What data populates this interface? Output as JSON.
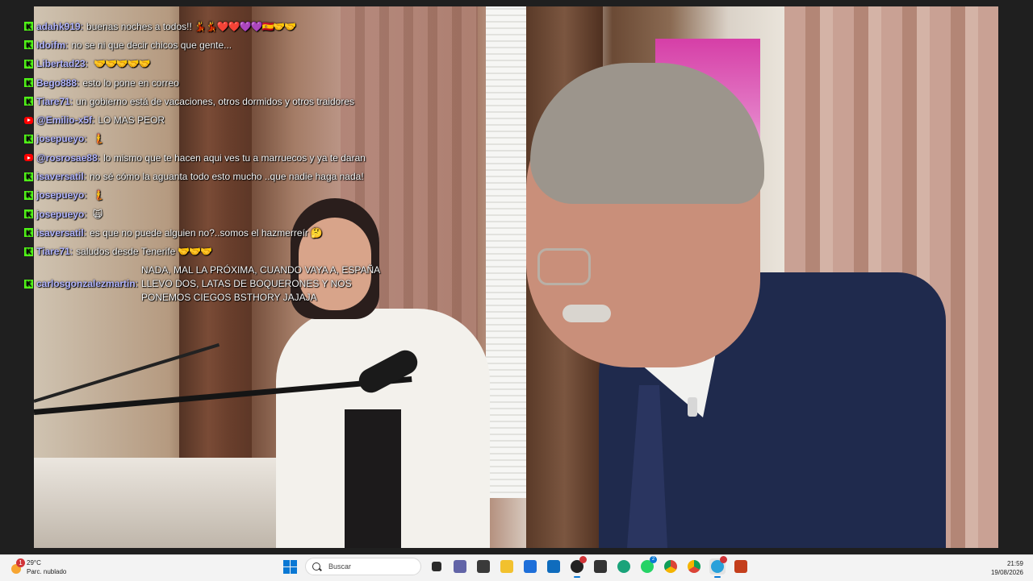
{
  "chat": [
    {
      "platform": "kick",
      "user": "adahk919",
      "text": "buenas noches a todos!!",
      "emotes": "💃💃❤️❤️💜💜🇪🇸🤝🤝"
    },
    {
      "platform": "kick",
      "user": "Idoifm",
      "text": "no se ni que decir chicos que gente...",
      "emotes": ""
    },
    {
      "platform": "kick",
      "user": "Libertad23",
      "text": "",
      "emotes": "🤝🤝🤝🤝🤝"
    },
    {
      "platform": "kick",
      "user": "Bego888",
      "text": "esto lo pone en correo",
      "emotes": ""
    },
    {
      "platform": "kick",
      "user": "Tiare71",
      "text": "un gobierno está de vacaciones, otros dormidos y otros traidores",
      "emotes": ""
    },
    {
      "platform": "youtube",
      "user": "@Emilio-x5f",
      "text": "LO MAS PEOR",
      "emotes": ""
    },
    {
      "platform": "kick",
      "user": "josepueyo",
      "text": "",
      "emotes": "🧜"
    },
    {
      "platform": "youtube",
      "user": "@rosrosae88",
      "text": "lo mismo que te hacen aqui ves tu a marruecos y ya te daran",
      "emotes": ""
    },
    {
      "platform": "kick",
      "user": "isaversatil",
      "text": "no sé cómo la aguanta todo esto mucho ..que nadie haga nada!",
      "emotes": ""
    },
    {
      "platform": "kick",
      "user": "josepueyo",
      "text": "",
      "emotes": "🧜"
    },
    {
      "platform": "kick",
      "user": "josepueyo",
      "text": "",
      "emotes": "🙀"
    },
    {
      "platform": "kick",
      "user": "isaversatil",
      "text": "es que no puede alguien no?..somos el hazmerreír",
      "emotes": "🤔"
    },
    {
      "platform": "kick",
      "user": "Tiare71",
      "text": "saludos desde Tenerife",
      "emotes": "🤝🤝🤝"
    },
    {
      "platform": "kick",
      "user": "carlosgonzalezmartin",
      "text": "NADA, MAL LA PRÓXIMA, CUANDO VAYA A, ESPAÑA LLEVO DOS, LATAS DE BOQUERONES Y NOS PONEMOS CIEGOS BSTHORY JAJAJA",
      "emotes": ""
    }
  ],
  "taskbar": {
    "weather": {
      "temp": "29°C",
      "desc": "Parc. nublado",
      "badge": "1"
    },
    "search_placeholder": "Buscar",
    "apps": [
      {
        "name": "task-view",
        "color": "#2b2b2b",
        "glyph": "▣",
        "badge": ""
      },
      {
        "name": "teams",
        "color": "#6264a7",
        "glyph": "👥",
        "badge": ""
      },
      {
        "name": "shield-app",
        "color": "#3a3a3a",
        "glyph": "🛡",
        "badge": ""
      },
      {
        "name": "file-explorer",
        "color": "#f2c12e",
        "glyph": "📁",
        "badge": ""
      },
      {
        "name": "microsoft-store",
        "color": "#1e6fd9",
        "glyph": "🛍",
        "badge": ""
      },
      {
        "name": "outlook",
        "color": "#0f6cbd",
        "glyph": "✉",
        "badge": ""
      },
      {
        "name": "obs",
        "color": "#222",
        "glyph": "●",
        "badge": "•"
      },
      {
        "name": "cube-app",
        "color": "#333",
        "glyph": "⬢",
        "badge": ""
      },
      {
        "name": "edge",
        "color": "#1aa37a",
        "glyph": "◉",
        "badge": ""
      },
      {
        "name": "whatsapp",
        "color": "#25d366",
        "glyph": "✆",
        "badge": "2"
      },
      {
        "name": "chrome",
        "color": "#db4437",
        "glyph": "◎",
        "badge": ""
      },
      {
        "name": "chrome-2",
        "color": "#0f9d58",
        "glyph": "◎",
        "badge": ""
      },
      {
        "name": "telegram",
        "color": "#2aa1da",
        "glyph": "➤",
        "badge": "•"
      },
      {
        "name": "powerpoint",
        "color": "#c43e1c",
        "glyph": "P",
        "badge": ""
      }
    ],
    "time": "21:59",
    "date": "19/08/2026"
  }
}
